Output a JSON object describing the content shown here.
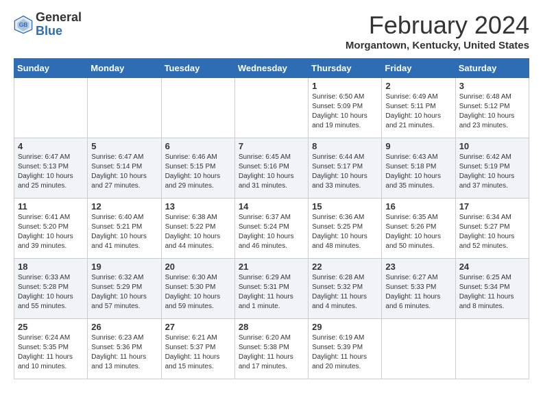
{
  "app": {
    "name": "GeneralBlue",
    "title": "February 2024",
    "location": "Morgantown, Kentucky, United States"
  },
  "calendar": {
    "days_of_week": [
      "Sunday",
      "Monday",
      "Tuesday",
      "Wednesday",
      "Thursday",
      "Friday",
      "Saturday"
    ],
    "weeks": [
      [
        {
          "day": "",
          "info": ""
        },
        {
          "day": "",
          "info": ""
        },
        {
          "day": "",
          "info": ""
        },
        {
          "day": "",
          "info": ""
        },
        {
          "day": "1",
          "info": "Sunrise: 6:50 AM\nSunset: 5:09 PM\nDaylight: 10 hours\nand 19 minutes."
        },
        {
          "day": "2",
          "info": "Sunrise: 6:49 AM\nSunset: 5:11 PM\nDaylight: 10 hours\nand 21 minutes."
        },
        {
          "day": "3",
          "info": "Sunrise: 6:48 AM\nSunset: 5:12 PM\nDaylight: 10 hours\nand 23 minutes."
        }
      ],
      [
        {
          "day": "4",
          "info": "Sunrise: 6:47 AM\nSunset: 5:13 PM\nDaylight: 10 hours\nand 25 minutes."
        },
        {
          "day": "5",
          "info": "Sunrise: 6:47 AM\nSunset: 5:14 PM\nDaylight: 10 hours\nand 27 minutes."
        },
        {
          "day": "6",
          "info": "Sunrise: 6:46 AM\nSunset: 5:15 PM\nDaylight: 10 hours\nand 29 minutes."
        },
        {
          "day": "7",
          "info": "Sunrise: 6:45 AM\nSunset: 5:16 PM\nDaylight: 10 hours\nand 31 minutes."
        },
        {
          "day": "8",
          "info": "Sunrise: 6:44 AM\nSunset: 5:17 PM\nDaylight: 10 hours\nand 33 minutes."
        },
        {
          "day": "9",
          "info": "Sunrise: 6:43 AM\nSunset: 5:18 PM\nDaylight: 10 hours\nand 35 minutes."
        },
        {
          "day": "10",
          "info": "Sunrise: 6:42 AM\nSunset: 5:19 PM\nDaylight: 10 hours\nand 37 minutes."
        }
      ],
      [
        {
          "day": "11",
          "info": "Sunrise: 6:41 AM\nSunset: 5:20 PM\nDaylight: 10 hours\nand 39 minutes."
        },
        {
          "day": "12",
          "info": "Sunrise: 6:40 AM\nSunset: 5:21 PM\nDaylight: 10 hours\nand 41 minutes."
        },
        {
          "day": "13",
          "info": "Sunrise: 6:38 AM\nSunset: 5:22 PM\nDaylight: 10 hours\nand 44 minutes."
        },
        {
          "day": "14",
          "info": "Sunrise: 6:37 AM\nSunset: 5:24 PM\nDaylight: 10 hours\nand 46 minutes."
        },
        {
          "day": "15",
          "info": "Sunrise: 6:36 AM\nSunset: 5:25 PM\nDaylight: 10 hours\nand 48 minutes."
        },
        {
          "day": "16",
          "info": "Sunrise: 6:35 AM\nSunset: 5:26 PM\nDaylight: 10 hours\nand 50 minutes."
        },
        {
          "day": "17",
          "info": "Sunrise: 6:34 AM\nSunset: 5:27 PM\nDaylight: 10 hours\nand 52 minutes."
        }
      ],
      [
        {
          "day": "18",
          "info": "Sunrise: 6:33 AM\nSunset: 5:28 PM\nDaylight: 10 hours\nand 55 minutes."
        },
        {
          "day": "19",
          "info": "Sunrise: 6:32 AM\nSunset: 5:29 PM\nDaylight: 10 hours\nand 57 minutes."
        },
        {
          "day": "20",
          "info": "Sunrise: 6:30 AM\nSunset: 5:30 PM\nDaylight: 10 hours\nand 59 minutes."
        },
        {
          "day": "21",
          "info": "Sunrise: 6:29 AM\nSunset: 5:31 PM\nDaylight: 11 hours\nand 1 minute."
        },
        {
          "day": "22",
          "info": "Sunrise: 6:28 AM\nSunset: 5:32 PM\nDaylight: 11 hours\nand 4 minutes."
        },
        {
          "day": "23",
          "info": "Sunrise: 6:27 AM\nSunset: 5:33 PM\nDaylight: 11 hours\nand 6 minutes."
        },
        {
          "day": "24",
          "info": "Sunrise: 6:25 AM\nSunset: 5:34 PM\nDaylight: 11 hours\nand 8 minutes."
        }
      ],
      [
        {
          "day": "25",
          "info": "Sunrise: 6:24 AM\nSunset: 5:35 PM\nDaylight: 11 hours\nand 10 minutes."
        },
        {
          "day": "26",
          "info": "Sunrise: 6:23 AM\nSunset: 5:36 PM\nDaylight: 11 hours\nand 13 minutes."
        },
        {
          "day": "27",
          "info": "Sunrise: 6:21 AM\nSunset: 5:37 PM\nDaylight: 11 hours\nand 15 minutes."
        },
        {
          "day": "28",
          "info": "Sunrise: 6:20 AM\nSunset: 5:38 PM\nDaylight: 11 hours\nand 17 minutes."
        },
        {
          "day": "29",
          "info": "Sunrise: 6:19 AM\nSunset: 5:39 PM\nDaylight: 11 hours\nand 20 minutes."
        },
        {
          "day": "",
          "info": ""
        },
        {
          "day": "",
          "info": ""
        }
      ]
    ]
  }
}
